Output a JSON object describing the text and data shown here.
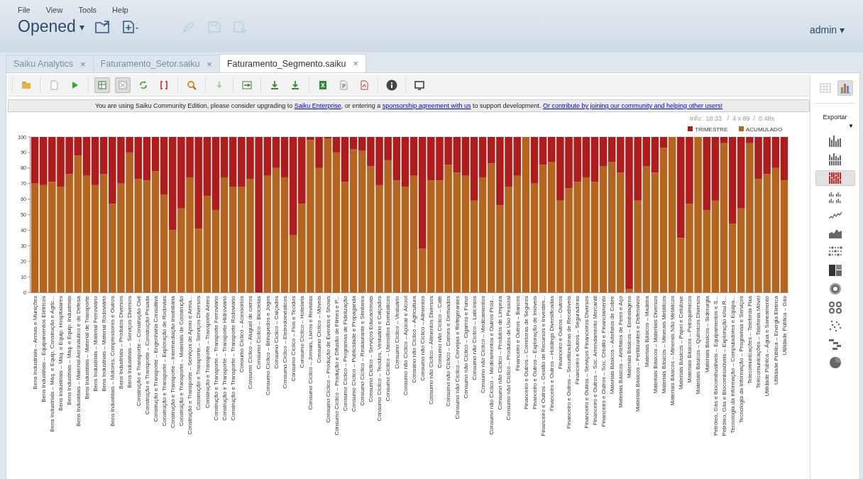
{
  "menu": [
    "File",
    "View",
    "Tools",
    "Help"
  ],
  "header": {
    "title": "Opened",
    "title_caret": "▾",
    "user": "admin",
    "user_caret": "▾",
    "buttons": [
      {
        "kind": "open",
        "disabled": false
      },
      {
        "kind": "new",
        "disabled": false
      },
      {
        "kind": "edit",
        "disabled": true
      },
      {
        "kind": "save",
        "disabled": true
      },
      {
        "kind": "saveas",
        "disabled": true
      }
    ]
  },
  "tabs": [
    {
      "label": "Saiku Analytics",
      "close": "×",
      "selected": false
    },
    {
      "label": "Faturamento_Setor.saiku",
      "close": "×",
      "selected": false
    },
    {
      "label": "Faturamento_Segmento.saiku",
      "close": "×",
      "selected": true
    }
  ],
  "toolbar": [
    [
      {
        "kind": "folder",
        "pressed": false
      }
    ],
    [
      {
        "kind": "page",
        "pressed": false
      },
      {
        "kind": "play",
        "pressed": false
      }
    ],
    [
      {
        "kind": "table-in",
        "pressed": true
      },
      {
        "kind": "table-x",
        "pressed": true
      },
      {
        "kind": "refresh",
        "pressed": false
      },
      {
        "kind": "brackets",
        "pressed": false
      }
    ],
    [
      {
        "kind": "search",
        "pressed": false
      }
    ],
    [
      {
        "kind": "arrow-down",
        "pressed": false
      }
    ],
    [
      {
        "kind": "swap",
        "pressed": false
      }
    ],
    [
      {
        "kind": "download",
        "pressed": false
      },
      {
        "kind": "download",
        "pressed": false
      }
    ],
    [
      {
        "kind": "excel",
        "pressed": false
      },
      {
        "kind": "csv",
        "pressed": false
      },
      {
        "kind": "pdf",
        "pressed": false
      }
    ],
    [
      {
        "kind": "info",
        "pressed": false
      }
    ],
    [
      {
        "kind": "screen",
        "pressed": false
      }
    ]
  ],
  "notice": [
    {
      "kind": "text",
      "text": "You are using Saiku Community Edition, please consider upgrading to "
    },
    {
      "kind": "link",
      "text": "Saiku Enterprise"
    },
    {
      "kind": "text",
      "text": ", or entering a "
    },
    {
      "kind": "link",
      "text": "sponsorship agreement with us"
    },
    {
      "kind": "text",
      "text": " to support development. "
    },
    {
      "kind": "link",
      "text": "Or contribute by joining our community and helping other users!"
    }
  ],
  "info": "Info:  18:33   /  4 x 89  /  0.48s",
  "chart_data": {
    "type": "bar",
    "stacked": true,
    "legend": "top-right",
    "orientation": "vertical",
    "ylim": [
      0,
      100
    ],
    "yticks": [
      0,
      10,
      20,
      30,
      40,
      50,
      60,
      70,
      80,
      90,
      100
    ],
    "categories": [
      "Bens Industriais – Armas e Munições",
      "Bens Industriais – Equipamentos Elétricos",
      "Bens Industriais – Máq. e Equip. Construção e Agric...",
      "Bens Industriais – Máq. e Equip. Hospitalares",
      "Bens Industriais – Máq. e Equip. Industriais",
      "Bens Industriais – Material Aeronáutico e de Defesa",
      "Bens Industriais – Material de Transporte",
      "Bens Industriais – Material Ferroviário",
      "Bens Industriais – Material Rodoviário",
      "Bens Industriais – Motores, Compressores e Outros",
      "Bens Industriais – Produtos Diversos",
      "Bens Industriais – Serviços Diversos",
      "Construção e Transporte – Construção Civil",
      "Construção e Transporte – Construção Pesada",
      "Construção e Transporte – Engenharia Consultiva",
      "Construção e Transporte – Exploração de Rodovias",
      "Construção e Transporte – Intermediação Imobiliária",
      "Construção e Transporte – Materiais de Construção",
      "Construção e Transporte – Serviços de Apoio e Arma...",
      "Construção e Transporte – Serviços Diversos",
      "Construção e Transporte – Transporte Aéreo",
      "Construção e Transporte – Transporte Ferroviário",
      "Construção e Transporte – Transporte Hidroviário",
      "Construção e Transporte – Transporte Rodoviário",
      "Consumo Cíclico – Acessórios",
      "Consumo Cíclico – Aluguel de carros",
      "Consumo Cíclico – Bicicletas",
      "Consumo Cíclico – Brinquedos e Jogos",
      "Consumo Cíclico – Calçados",
      "Consumo Cíclico – Eletrodomésticos",
      "Consumo Cíclico – Fios e Tecidos",
      "Consumo Cíclico – Hotelaria",
      "Consumo Cíclico – Jornais, Livros e Revistas",
      "Consumo Cíclico – Móveis",
      "Consumo Cíclico – Produção de Eventos e Shows",
      "Consumo Cíclico – Produção e Difusão de Filmes e P...",
      "Consumo Cíclico – Programas de Fidelização",
      "Consumo Cíclico – Publicidade e Propaganda",
      "Consumo Cíclico – Restaurante e Similares",
      "Consumo Cíclico – Serviços Educacionais",
      "Consumo Cíclico – Tecidos, Vestuário e Calçados",
      "Consumo Cíclico – Utensílios Domésticos",
      "Consumo Cíclico – Vestuário",
      "Consumo não Cíclico – Açúcar e Álcool",
      "Consumo não Cíclico – Agricultura",
      "Consumo não Cíclico – Alimentos",
      "Consumo não Cíclico – Alimentos Diversos",
      "Consumo não Cíclico – Café",
      "Consumo não Cíclico – Carnes e Derivados",
      "Consumo não Cíclico – Cervejas e Refrigerantes",
      "Consumo não Cíclico – Cigarros e Fumo",
      "Consumo não Cíclico – Laticínios",
      "Consumo não Cíclico – Medicamentos",
      "Consumo não Cíclico – Medicamentos e Outros Prod...",
      "Consumo não Cíclico – Produtos de Limpeza",
      "Consumo não Cíclico – Produtos de Uso Pessoal",
      "Financeiro e Outros – Bancos",
      "Financeiro e Outros – Corretoras de Seguros",
      "Financeiro e Outros – Exploração de Imóveis",
      "Financeiro e Outros – Gestão de Recursos e Investim...",
      "Financeiro e Outros – Holdings Diversificadas",
      "Financeiro e Outros – Outros",
      "Financeiro e Outros – Securitizadoras de Recebíveis",
      "Financeiro e Outros – Seguradoras",
      "Financeiro e Outros – Serviços Financeiros Diversos",
      "Financeiro e Outros – Soc. Arrendamento Mercantil",
      "Financeiro e Outros – Soc. Crédito e Financiamento",
      "Materiais Básicos – Artefatos de Cobre",
      "Materiais Básicos – Artefatos de Ferro e Aço",
      "Materiais Básicos – Embalagens",
      "Materiais Básicos – Fertilizantes e Defensivos",
      "Materiais Básicos – Madeira",
      "Materiais Básicos – Materiais Diversos",
      "Materiais Básicos – Minerais Metálicos",
      "Materiais Básicos – Minerais Não Metálicos",
      "Materiais Básicos – Papel e Celulose",
      "Materiais Básicos – Petroquímicos",
      "Materiais Básicos – Químicos Diversos",
      "Materiais Básicos – Siderurgia",
      "Petróleo, Gás e Biocombustíveis – Equipamentos e S...",
      "Petróleo, Gás e Biocombustíveis – Exploração e/ou R...",
      "Tecnologia da Informação – Computadores e Equipa...",
      "Tecnologia da Informação – Programas e Serviços",
      "Telecomunicações – Telefonia Fixa",
      "Telecomunicações – Telefonia Móvel",
      "Utilidade Pública – Água e Saneamento",
      "Utilidade Pública – Energia Elétrica",
      "Utilidade Pública – Gás"
    ],
    "series": [
      {
        "name": "TRIMESTRE",
        "color": "#b01c1c",
        "values": [
          30,
          31,
          29,
          32,
          24,
          12,
          25,
          31,
          24,
          43,
          30,
          10,
          27,
          28,
          22,
          37,
          60,
          46,
          26,
          59,
          38,
          47,
          26,
          32,
          32,
          27,
          100,
          25,
          20,
          26,
          63,
          43,
          2,
          20,
          1,
          10,
          29,
          8,
          9,
          19,
          31,
          15,
          28,
          32,
          25,
          72,
          28,
          28,
          18,
          23,
          25,
          41,
          26,
          17,
          44,
          32,
          25,
          0,
          30,
          18,
          16,
          41,
          33,
          29,
          26,
          29,
          19,
          16,
          23,
          98,
          41,
          19,
          23,
          7,
          0,
          65,
          43,
          0,
          47,
          41,
          4,
          56,
          46,
          4,
          27,
          24,
          20,
          28
        ]
      },
      {
        "name": "ACUMULADO",
        "color": "#b5651d",
        "values": [
          70,
          69,
          71,
          68,
          76,
          88,
          75,
          69,
          76,
          57,
          70,
          90,
          73,
          72,
          78,
          63,
          40,
          54,
          74,
          41,
          62,
          53,
          74,
          68,
          68,
          73,
          0,
          75,
          80,
          74,
          37,
          57,
          98,
          80,
          99,
          90,
          71,
          92,
          91,
          81,
          69,
          85,
          72,
          68,
          75,
          28,
          72,
          72,
          82,
          77,
          75,
          59,
          74,
          83,
          56,
          68,
          75,
          100,
          70,
          82,
          84,
          59,
          67,
          71,
          74,
          71,
          81,
          84,
          77,
          2,
          59,
          81,
          77,
          93,
          100,
          35,
          57,
          100,
          53,
          59,
          96,
          44,
          54,
          96,
          73,
          76,
          80,
          72
        ]
      }
    ]
  },
  "side": {
    "views": [
      {
        "kind": "table",
        "selected": false
      },
      {
        "kind": "chart",
        "selected": true
      }
    ],
    "export_label": "Exportar",
    "export_caret": "▼",
    "chart_types": [
      {
        "kind": "bar",
        "selected": false
      },
      {
        "kind": "stacked",
        "selected": false
      },
      {
        "kind": "stacked100",
        "selected": true
      },
      {
        "kind": "multiple",
        "selected": false
      },
      {
        "kind": "line",
        "selected": false
      },
      {
        "kind": "area",
        "selected": false
      },
      {
        "kind": "dots",
        "selected": false
      },
      {
        "kind": "treemap",
        "selected": false
      },
      {
        "kind": "sunburst",
        "selected": false
      },
      {
        "kind": "donuts",
        "selected": false
      },
      {
        "kind": "scatter",
        "selected": false
      },
      {
        "kind": "waterfall",
        "selected": false
      },
      {
        "kind": "pie",
        "selected": false
      }
    ]
  }
}
